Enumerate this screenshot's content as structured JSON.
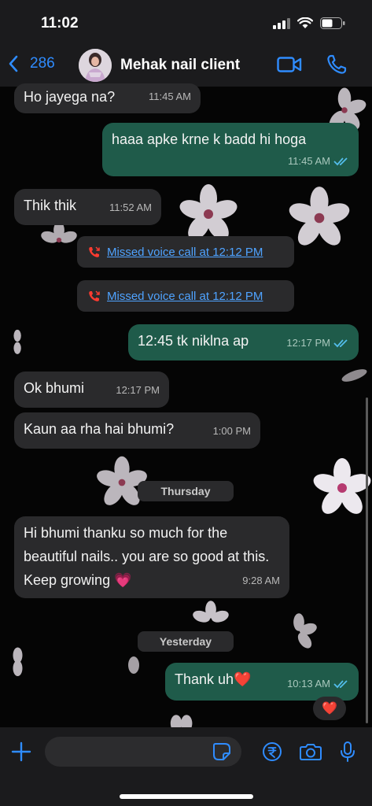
{
  "status_bar": {
    "time": "11:02"
  },
  "header": {
    "back_count": "286",
    "contact_name": "Mehak nail client"
  },
  "messages": [
    {
      "text": "Ho jayega na?",
      "time": "11:45 AM"
    },
    {
      "text": "haaa apke krne k badd hi hoga",
      "time": "11:45 AM"
    },
    {
      "text": "Thik thik",
      "time": "11:52 AM"
    },
    {
      "text": "Missed voice call at 12:12 PM"
    },
    {
      "text": "Missed voice call at 12:12 PM"
    },
    {
      "text": "12:45 tk niklna ap",
      "time": "12:17 PM"
    },
    {
      "text": "Ok bhumi",
      "time": "12:17 PM"
    },
    {
      "text": "Kaun aa rha hai bhumi?",
      "time": "1:00 PM"
    },
    {
      "text": "Hi bhumi thanku so much for the beautiful nails.. you are so good at this. Keep growing 💗",
      "time": "9:28 AM"
    },
    {
      "text": "Thank uh❤️",
      "time": "10:13 AM"
    }
  ],
  "dates": {
    "thursday": "Thursday",
    "yesterday": "Yesterday"
  },
  "reaction": "❤️",
  "colors": {
    "accent_blue": "#2f8cff",
    "incoming_bubble": "#2a2a2c",
    "outgoing_bubble": "#1f5b4a",
    "read_ticks": "#53bdeb",
    "missed_call_red": "#ff3b30"
  },
  "icons": [
    "signal-icon",
    "wifi-icon",
    "battery-icon",
    "back-chevron-icon",
    "video-call-icon",
    "phone-icon",
    "missed-call-icon",
    "plus-icon",
    "sticker-icon",
    "rupee-icon",
    "camera-icon",
    "mic-icon"
  ]
}
